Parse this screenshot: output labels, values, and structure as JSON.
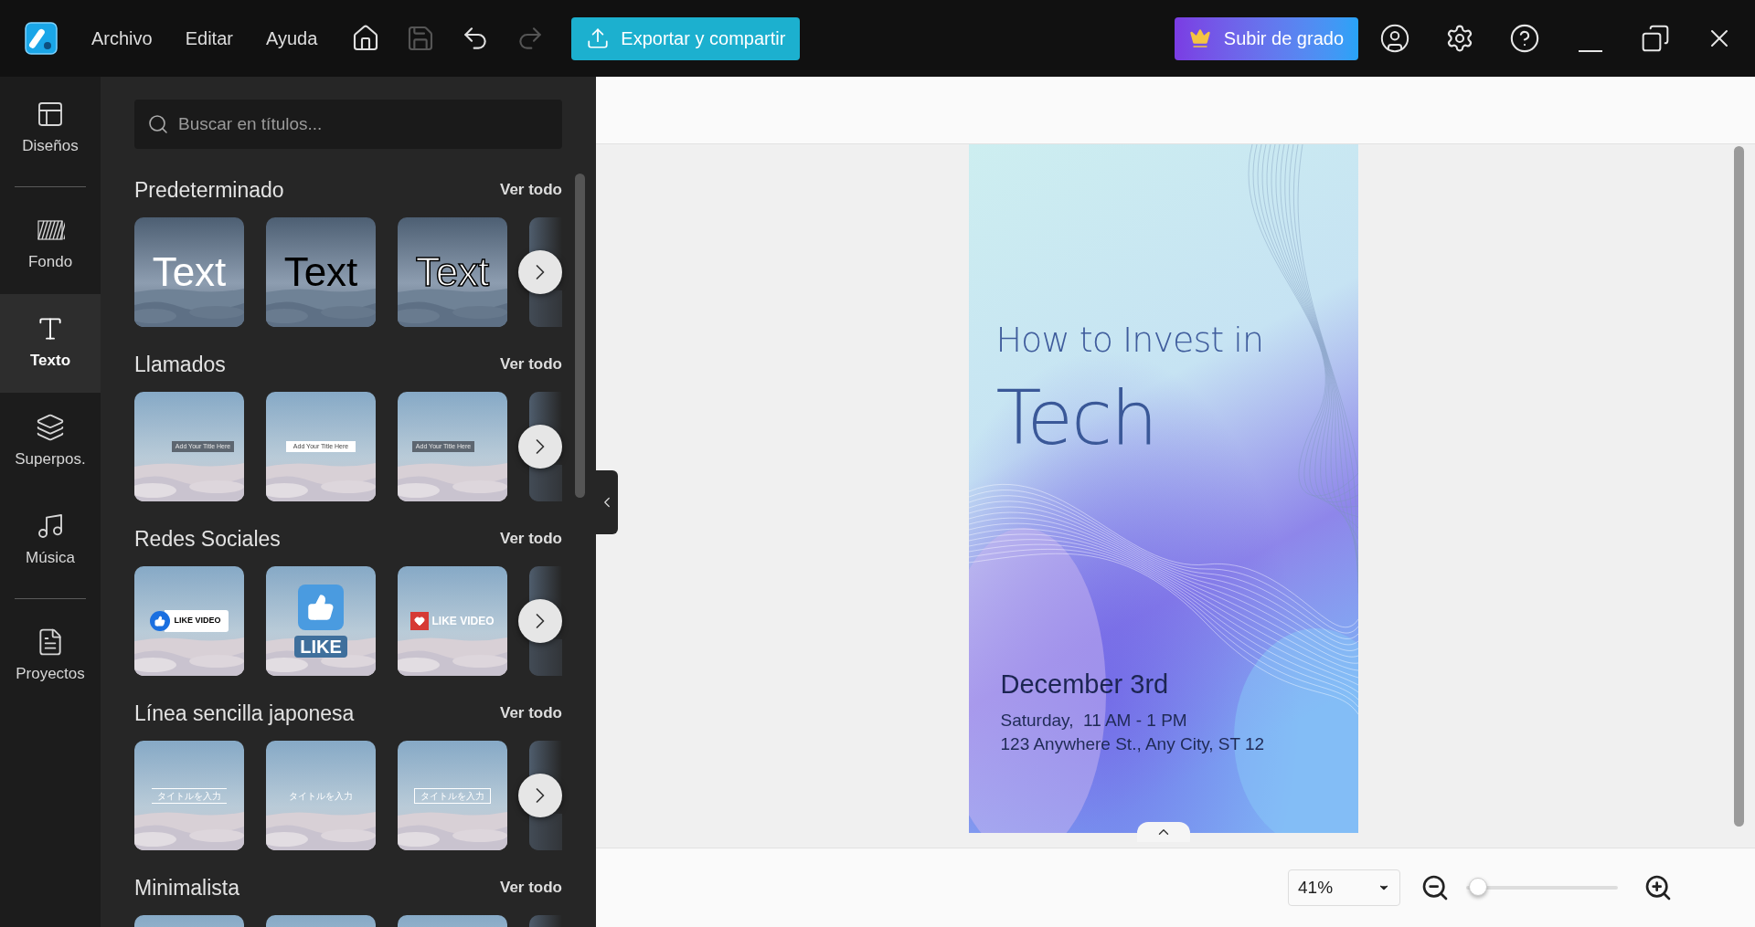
{
  "menu": [
    "Archivo",
    "Editar",
    "Ayuda"
  ],
  "toolbar_buttons": [
    {
      "kind": "home",
      "disabled": false
    },
    {
      "kind": "save",
      "disabled": true
    },
    {
      "kind": "undo",
      "disabled": false
    },
    {
      "kind": "redo",
      "disabled": true
    }
  ],
  "export_button": "Exportar y compartir",
  "upgrade_button": "Subir de grado",
  "rail_groups": [
    {
      "items": [
        {
          "kind": "layouts",
          "label": "Diseños",
          "selected": false
        }
      ]
    },
    {
      "items": [
        {
          "kind": "background",
          "label": "Fondo",
          "selected": false
        },
        {
          "kind": "text",
          "label": "Texto",
          "selected": true
        },
        {
          "kind": "overlays",
          "label": "Superpos.",
          "selected": false
        },
        {
          "kind": "music",
          "label": "Música",
          "selected": false
        }
      ]
    },
    {
      "items": [
        {
          "kind": "projects",
          "label": "Proyectos",
          "selected": false
        }
      ]
    }
  ],
  "search": {
    "placeholder": "Buscar en títulos..."
  },
  "sections": [
    {
      "title": "Predeterminado",
      "action": "Ver todo",
      "thumbs": [
        {
          "kind": "plain-white",
          "text": "Text"
        },
        {
          "kind": "plain-black",
          "text": "Text"
        },
        {
          "kind": "outline",
          "text": "Text"
        }
      ]
    },
    {
      "title": "Llamados",
      "action": "Ver todo",
      "thumbs": [
        {
          "kind": "callout-left",
          "text": "Add Your Title Here"
        },
        {
          "kind": "callout-white",
          "text": "Add Your Title Here"
        },
        {
          "kind": "callout-right",
          "text": "Add Your Title Here"
        }
      ]
    },
    {
      "title": "Redes Sociales",
      "action": "Ver todo",
      "thumbs": [
        {
          "kind": "like-pill",
          "text": "LIKE VIDEO"
        },
        {
          "kind": "like-thumb",
          "text": "LIKE"
        },
        {
          "kind": "like-heart",
          "text": "LIKE VIDEO"
        }
      ]
    },
    {
      "title": "Línea sencilla japonesa",
      "action": "Ver todo",
      "thumbs": [
        {
          "kind": "line-under",
          "text": "タイトルを入力"
        },
        {
          "kind": "line-sides",
          "text": "タイトルを入力"
        },
        {
          "kind": "line-frame",
          "text": "タイトルを入力"
        }
      ]
    },
    {
      "title": "Minimalista",
      "action": "Ver todo",
      "thumbs": [
        {
          "kind": "blank"
        },
        {
          "kind": "blank"
        },
        {
          "kind": "blank"
        }
      ]
    }
  ],
  "poster": {
    "lines": [
      {
        "kind": "subtitle",
        "text": "How to Invest in"
      },
      {
        "kind": "title",
        "text": "Tech"
      },
      {
        "kind": "date",
        "text": "December 3rd"
      },
      {
        "kind": "detail",
        "text": "Saturday,  11 AM - 1 PM"
      },
      {
        "kind": "detail",
        "text": "123 Anywhere St., Any City, ST 12"
      }
    ]
  },
  "zoom": {
    "value": "41%",
    "level": 0.02
  }
}
